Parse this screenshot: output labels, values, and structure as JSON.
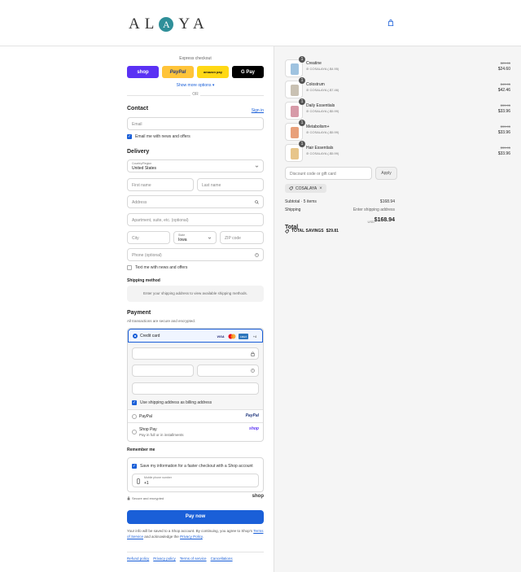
{
  "header": {
    "brand_left": "AL",
    "brand_mid": "A",
    "brand_right": "YA"
  },
  "express": {
    "label": "Express checkout",
    "buttons": [
      {
        "label": "shop",
        "bg": "#5a31f4",
        "fg": "#ffffff"
      },
      {
        "label": "PayPal",
        "bg": "#ffc439",
        "fg": "#253b80"
      },
      {
        "label": "amazon pay",
        "bg": "#ffd814",
        "fg": "#111111"
      },
      {
        "label": "G Pay",
        "bg": "#000000",
        "fg": "#ffffff"
      }
    ],
    "more_options": "Show more options ▾",
    "or": "OR"
  },
  "contact": {
    "title": "Contact",
    "sign_in": "Sign in",
    "email_placeholder": "Email",
    "news_label": "Email me with news and offers",
    "news_checked": true
  },
  "delivery": {
    "title": "Delivery",
    "country_label": "Country/Region",
    "country_value": "United States",
    "first_name": "First name",
    "last_name": "Last name",
    "address": "Address",
    "apartment": "Apartment, suite, etc. (optional)",
    "city": "City",
    "state_label": "State",
    "state_value": "Iowa",
    "zip": "ZIP code",
    "phone": "Phone (optional)",
    "text_news_label": "Text me with news and offers",
    "text_news_checked": false
  },
  "shipping": {
    "title": "Shipping method",
    "message": "Enter your shipping address to view available shipping methods."
  },
  "payment": {
    "title": "Payment",
    "subtitle": "All transactions are secure and encrypted.",
    "credit_card_label": "Credit card",
    "card_logos": [
      "VISA",
      "MC",
      "AMEX",
      "+4"
    ],
    "billing_label": "Use shipping address as billing address",
    "billing_checked": true,
    "paypal_label": "PayPal",
    "paypal_brand": "PayPal",
    "shoppay_label": "Shop Pay",
    "shoppay_sub": "Pay in full or in installments",
    "shoppay_brand": "shop"
  },
  "remember": {
    "title": "Remember me",
    "save_label": "Save my information for a faster checkout with a Shop account",
    "save_checked": true,
    "mobile_label": "Mobile phone number",
    "mobile_value": "+1",
    "secure_label": "Secure and encrypted",
    "shop_brand": "shop"
  },
  "pay_now": "Pay now",
  "legal": {
    "prefix": "Your info will be saved to a Shop account. By continuing, you agree to Shop's ",
    "terms": "Terms of Service",
    "middle": " and acknowledge the ",
    "privacy": "Privacy Policy",
    "suffix": "."
  },
  "footer": {
    "links": [
      "Refund policy",
      "Privacy policy",
      "Terms of service",
      "Cancellations"
    ]
  },
  "order": {
    "items": [
      {
        "name": "Creatine",
        "qty": "1",
        "discount": "COSALAYA (-$4.95)",
        "old_price": "$29.55",
        "new_price": "$24.60",
        "color": "#9fc3e0"
      },
      {
        "name": "Colostrum",
        "qty": "1",
        "discount": "COSALAYA (-$7.46)",
        "old_price": "$49.95",
        "new_price": "$42.46",
        "color": "#c9c1b3"
      },
      {
        "name": "Daily Essentials",
        "qty": "1",
        "discount": "COSALAYA (-$5.99)",
        "old_price": "$39.95",
        "new_price": "$33.96",
        "color": "#d79aa8"
      },
      {
        "name": "Metabolism+",
        "qty": "1",
        "discount": "COSALAYA (-$5.99)",
        "old_price": "$39.95",
        "new_price": "$33.96",
        "color": "#e8a07a"
      },
      {
        "name": "Hair Essentials",
        "qty": "1",
        "discount": "COSALAYA (-$5.99)",
        "old_price": "$39.95",
        "new_price": "$33.96",
        "color": "#e7c58a"
      }
    ],
    "discount_placeholder": "Discount code or gift card",
    "apply": "Apply",
    "code_chip": "COSALAYA",
    "subtotal_label": "Subtotal · 5 items",
    "subtotal_value": "$168.94",
    "shipping_label": "Shipping",
    "shipping_value": "Enter shipping address",
    "total_label": "Total",
    "currency": "USD",
    "total_value": "$168.94",
    "savings_label": "TOTAL SAVINGS",
    "savings_value": "$29.81"
  },
  "colors": {
    "accent": "#1a5fd8",
    "brand_teal": "#2f8f99"
  }
}
